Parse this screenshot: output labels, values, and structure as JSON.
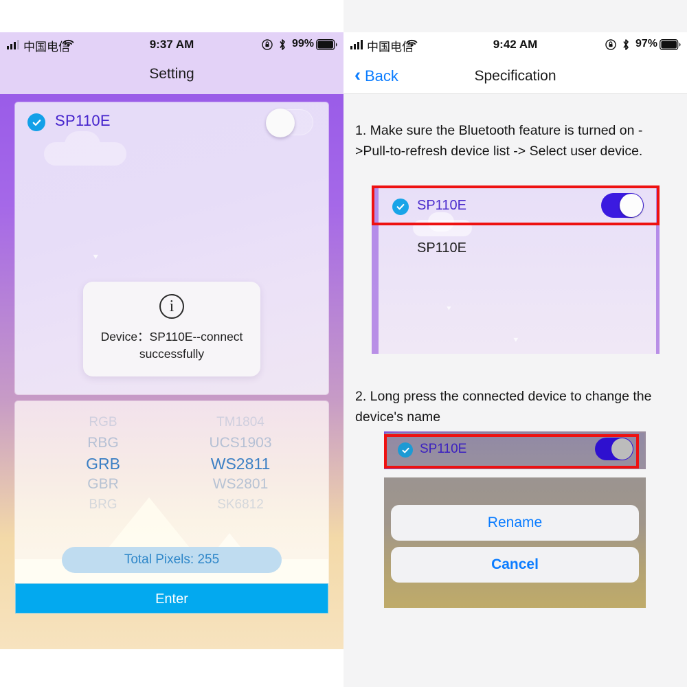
{
  "left": {
    "status": {
      "carrier": "中国电信",
      "time": "9:37 AM",
      "battery": "99%"
    },
    "nav": {
      "title": "Setting"
    },
    "device_card": {
      "name": "SP110E",
      "checked_icon": "check-circle-icon",
      "toggle_state": "on"
    },
    "toast": {
      "icon": "info-circle-icon",
      "line1": "Device：SP110E--connect",
      "line2": "successfully"
    },
    "picker": {
      "color_order": [
        "RGB",
        "RBG",
        "GRB",
        "GBR",
        "BRG"
      ],
      "color_selected": "GRB",
      "chip_type": [
        "TM1804",
        "UCS1903",
        "WS2811",
        "WS2801",
        "SK6812"
      ],
      "chip_selected": "WS2811"
    },
    "pixels_label": "Total Pixels: 255",
    "enter_label": "Enter"
  },
  "right": {
    "status": {
      "carrier": "中国电信",
      "time": "9:42 AM",
      "battery": "97%"
    },
    "nav": {
      "back_label": "Back",
      "title": "Specification"
    },
    "instructions": {
      "step1": "1. Make sure the Bluetooth feature is turned on ->Pull-to-refresh device list -> Select user device.",
      "step2": "2. Long press the connected device to change the device's name"
    },
    "shot1": {
      "device_name": "SP110E",
      "device_name_2": "SP110E",
      "toggle_state": "on",
      "highlight_color": "#ee1111"
    },
    "shot2": {
      "device_name": "SP110E",
      "toggle_state": "on",
      "highlight_color": "#ee1111",
      "action_rename": "Rename",
      "action_cancel": "Cancel"
    }
  },
  "colors": {
    "accent_blue": "#03a9ef",
    "link_blue": "#0a7cff",
    "device_purple": "#4422cc",
    "toggle_on": "#3b1ae0",
    "highlight_red": "#ee1111"
  }
}
